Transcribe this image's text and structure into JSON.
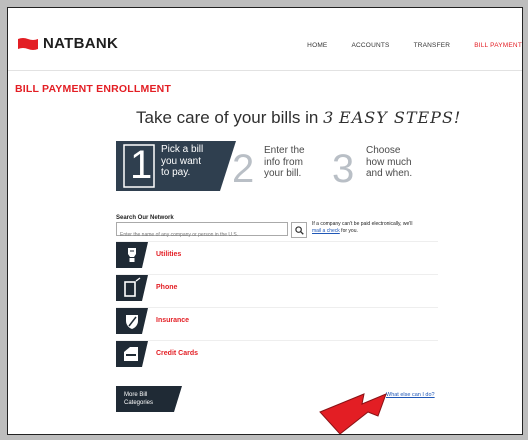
{
  "brand": {
    "name": "NATBANK",
    "accent": "#e31e24",
    "dark": "#1f2a35"
  },
  "nav": {
    "items": [
      {
        "label": "HOME",
        "active": false
      },
      {
        "label": "ACCOUNTS",
        "active": false
      },
      {
        "label": "TRANSFER",
        "active": false
      },
      {
        "label": "BILL PAYMENT",
        "active": true
      }
    ]
  },
  "page": {
    "title": "BILL PAYMENT ENROLLMENT"
  },
  "headline": {
    "text": "Take care of your bills in ",
    "number": "3",
    "emphasis": "EASY STEPS!"
  },
  "steps": [
    {
      "number": "1",
      "lines": [
        "Pick a bill",
        "you want",
        "to pay."
      ],
      "active": true
    },
    {
      "number": "2",
      "lines": [
        "Enter the",
        "info from",
        "your bill."
      ],
      "active": false
    },
    {
      "number": "3",
      "lines": [
        "Choose",
        "how much",
        "and when."
      ],
      "active": false
    }
  ],
  "search": {
    "label": "Search Our Network",
    "placeholder": "Enter the name of any company or person in the U.S.",
    "icon": "search-icon"
  },
  "note": {
    "text": "If a company can't be paid electronically, we'll",
    "link": "mail a check",
    "suffix": " for you."
  },
  "categories": [
    {
      "label": "Utilities",
      "icon": "utilities-icon"
    },
    {
      "label": "Phone",
      "icon": "phone-icon"
    },
    {
      "label": "Insurance",
      "icon": "insurance-icon"
    },
    {
      "label": "Credit Cards",
      "icon": "credit-card-icon"
    }
  ],
  "more": {
    "line1": "More Bill",
    "line2": "Categories"
  },
  "help_link": "What else can I do?"
}
